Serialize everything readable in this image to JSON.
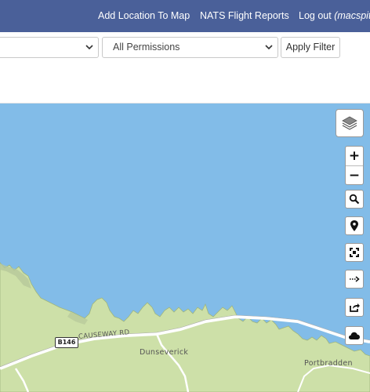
{
  "nav": {
    "add_location": "Add Location To Map",
    "flight_reports": "NATS Flight Reports",
    "logout_prefix": "Log out ",
    "logout_user": "(macspite)"
  },
  "filter": {
    "first_select_value": "",
    "permissions_select_value": "All Permissions",
    "apply_label": "Apply Filter"
  },
  "map_controls": {
    "layers_icon": "layers-icon",
    "zoom_in_label": "+",
    "zoom_out_label": "−",
    "tools": [
      "search-icon",
      "location-pin-icon",
      "fullscreen-icon",
      "measure-arrow-icon",
      "share-icon",
      "cloud-icon"
    ]
  },
  "map_labels": {
    "road_number": "B146",
    "road_name": "CAUSEWAY RD",
    "place_1": "Dunseverick",
    "place_2": "Portbradden"
  },
  "colors": {
    "header": "#4a6099",
    "sea": "#82bce8",
    "land": "#cde0a8"
  }
}
